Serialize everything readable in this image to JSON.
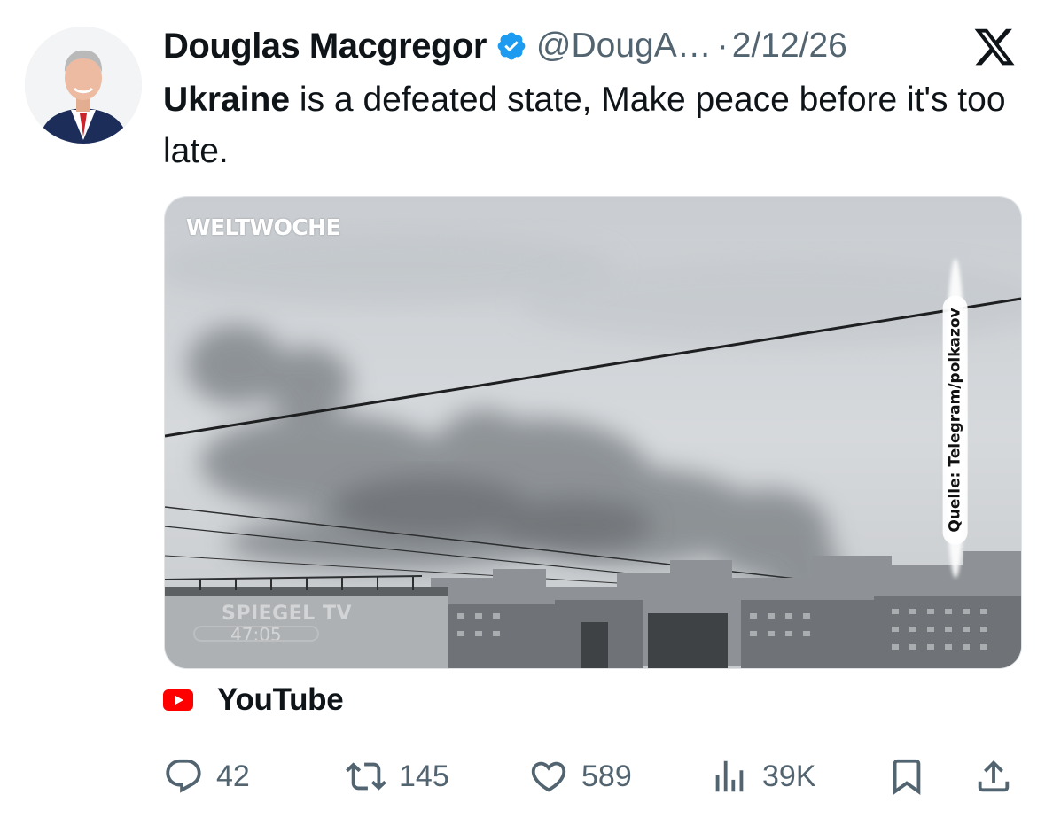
{
  "tweet": {
    "author_name": "Douglas Macgregor",
    "handle": "@DougA…",
    "separator": "·",
    "date": "2/12/26",
    "text_bold": "Ukraine",
    "text_rest": " is a defeated state, Make peace before it's too late."
  },
  "media": {
    "watermark_top": "WELTWOCHE",
    "watermark_bottom": "SPIEGEL TV",
    "watermark_counter": "47:05",
    "source_caption": "Quelle: Telegram/polkazov"
  },
  "link_card": {
    "source_name": "YouTube"
  },
  "actions": {
    "replies": "42",
    "reposts": "145",
    "likes": "589",
    "views": "39K"
  },
  "colors": {
    "verified_blue": "#1d9bf0",
    "text_primary": "#0f1419",
    "text_secondary": "#536471",
    "youtube_red": "#ff0000"
  },
  "icons": {
    "brand": "x-logo-icon",
    "verified": "verified-badge-icon",
    "reply": "reply-icon",
    "repost": "repost-icon",
    "like": "heart-icon",
    "views": "views-icon",
    "bookmark": "bookmark-icon",
    "share": "share-icon"
  }
}
